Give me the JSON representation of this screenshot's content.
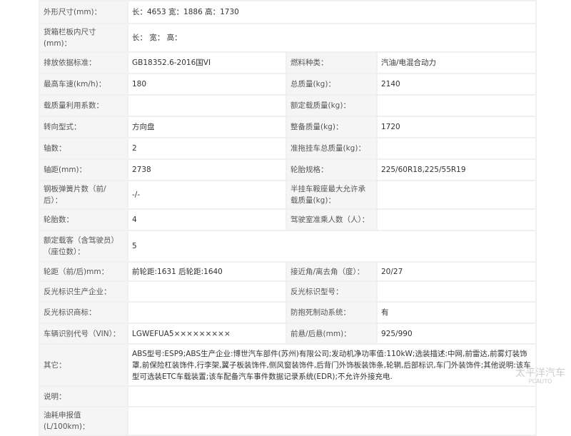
{
  "rows": [
    {
      "l1": "外形尺寸(mm)：",
      "v1": "长：4653 宽：1886 高：1730",
      "span": true
    },
    {
      "l1": "货箱栏板内尺寸(mm)：",
      "v1": "长： 宽： 高：",
      "span": true
    },
    {
      "l1": "排放依据标准：",
      "v1": "GB18352.6-2016国VI",
      "l2": "燃料种类：",
      "v2": "汽油/电混合动力"
    },
    {
      "l1": "最高车速(km/h)：",
      "v1": "180",
      "l2": "总质量(kg)：",
      "v2": "2140"
    },
    {
      "l1": "载质量利用系数：",
      "v1": "",
      "l2": "额定载质量(kg)：",
      "v2": ""
    },
    {
      "l1": "转向型式：",
      "v1": "方向盘",
      "l2": "整备质量(kg)：",
      "v2": "1720"
    },
    {
      "l1": "轴数：",
      "v1": "2",
      "l2": "准拖挂车总质量(kg)：",
      "v2": ""
    },
    {
      "l1": "轴距(mm)：",
      "v1": "2738",
      "l2": "轮胎规格：",
      "v2": "225/60R18,225/55R19"
    },
    {
      "l1": "钢板弹簧片数（前/后）：",
      "v1": "-/-",
      "l2": "半挂车鞍座最大允许承载质量(kg)：",
      "v2": ""
    },
    {
      "l1": "轮胎数：",
      "v1": "4",
      "l2": "驾驶室准乘人数（人）：",
      "v2": ""
    },
    {
      "l1": "额定载客（含驾驶员）（座位数）：",
      "v1": "5",
      "span": true
    },
    {
      "l1": "轮距（前/后)mm：",
      "v1": "前轮距:1631 后轮距:1640",
      "l2": "接近角/离去角（度）：",
      "v2": "20/27"
    },
    {
      "l1": "反光标识生产企业：",
      "v1": "",
      "l2": "反光标识型号：",
      "v2": ""
    },
    {
      "l1": "反光标识商标：",
      "v1": "",
      "l2": "防抱死制动系统：",
      "v2": "有"
    },
    {
      "l1": "车辆识别代号（VIN）：",
      "v1": "LGWEFUA5×××××××××",
      "l2": "前悬/后悬(mm)：",
      "v2": "925/990"
    },
    {
      "l1": "其它：",
      "v1": "ABS型号:ESP9;ABS生产企业:博世汽车部件(苏州)有限公司;发动机净功率值:110kW;选装描述:中网,前雷达,前雾灯装饰罩,前保险杠装饰件,行李架,翼子板装饰件,侧风窗装饰件,后背门外饰板装饰条,轮辋,后部标识,车门外装饰件;其他说明:该车型可选装ETC车载装置;该车配备汽车事件数据记录系统(EDR);不允许外接充电.",
      "span": true
    },
    {
      "l1": "说明：",
      "v1": "",
      "span": true
    },
    {
      "l1": "油耗申报值(L/100km)：",
      "v1": "",
      "span": true
    }
  ],
  "watermark": {
    "name": "太平洋汽车",
    "sub": "PCAUTO"
  }
}
